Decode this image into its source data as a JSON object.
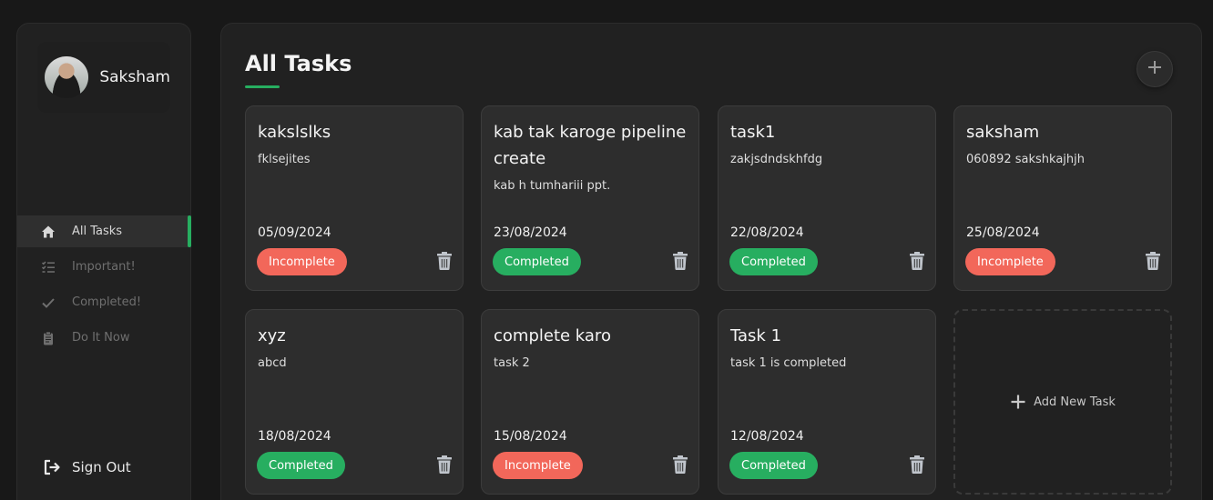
{
  "user": {
    "name": "Saksham"
  },
  "nav": [
    {
      "label": "All Tasks",
      "icon": "home-icon",
      "active": true
    },
    {
      "label": "Important!",
      "icon": "list-check-icon",
      "active": false
    },
    {
      "label": "Completed!",
      "icon": "check-icon",
      "active": false
    },
    {
      "label": "Do It Now",
      "icon": "clipboard-icon",
      "active": false
    }
  ],
  "signout": {
    "label": "Sign Out",
    "icon": "sign-out-icon"
  },
  "main": {
    "title": "All Tasks",
    "add_new_label": "Add New Task"
  },
  "tasks": [
    {
      "title": "kakslslks",
      "description": "fklsejites",
      "date": "05/09/2024",
      "status": "Incomplete"
    },
    {
      "title": "kab tak karoge pipeline create",
      "description": "kab h tumhariii ppt.",
      "date": "23/08/2024",
      "status": "Completed"
    },
    {
      "title": "task1",
      "description": "zakjsdndskhfdg",
      "date": "22/08/2024",
      "status": "Completed"
    },
    {
      "title": "saksham",
      "description": "060892 sakshkajhjh",
      "date": "25/08/2024",
      "status": "Incomplete"
    },
    {
      "title": "xyz",
      "description": "abcd",
      "date": "18/08/2024",
      "status": "Completed"
    },
    {
      "title": "complete karo",
      "description": "task 2",
      "date": "15/08/2024",
      "status": "Incomplete"
    },
    {
      "title": "Task 1",
      "description": "task 1 is completed",
      "date": "12/08/2024",
      "status": "Completed"
    }
  ],
  "colors": {
    "accent": "#27ae60",
    "completed": "#27ae60",
    "incomplete": "#f2675a",
    "background": "#181818",
    "panel": "#212121",
    "card": "#2d2d2d"
  }
}
